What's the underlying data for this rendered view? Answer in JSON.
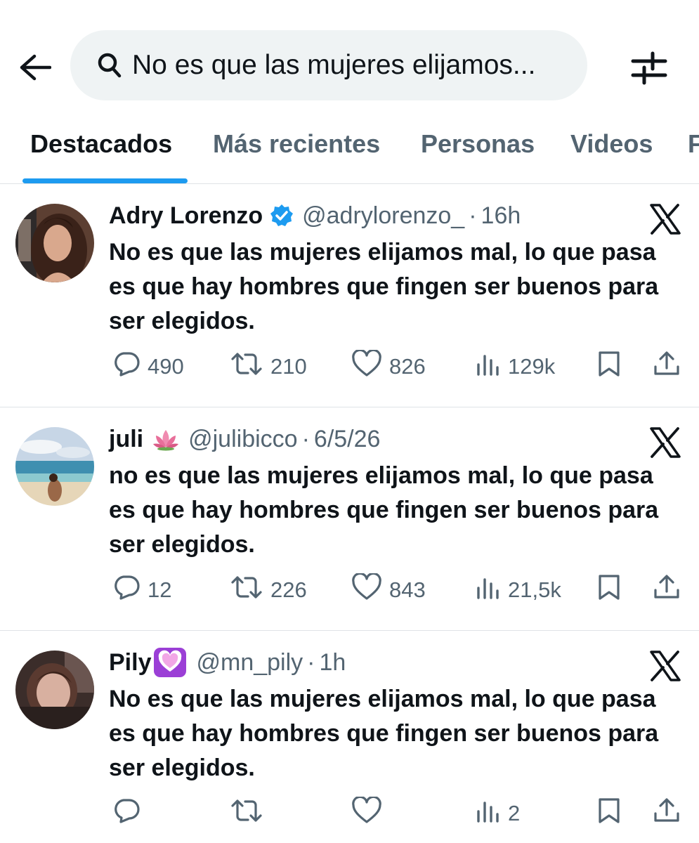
{
  "search": {
    "query": "No es que las mujeres elijamos..."
  },
  "tabs": [
    {
      "label": "Destacados",
      "active": true
    },
    {
      "label": "Más recientes",
      "active": false
    },
    {
      "label": "Personas",
      "active": false
    },
    {
      "label": "Videos",
      "active": false
    },
    {
      "label": "F",
      "active": false
    }
  ],
  "tweets": [
    {
      "name": "Adry Lorenzo",
      "verified": true,
      "handle": "@adrylorenzo_",
      "time": "16h",
      "text": "No es que las mujeres elijamos mal, lo que pasa es que hay hombres que fingen ser buenos para ser elegidos.",
      "replies": "490",
      "retweets": "210",
      "likes": "826",
      "views": "129k"
    },
    {
      "name": "juli",
      "emoji": "lotus-emoji",
      "handle": "@julibicco",
      "time": "6/5/26",
      "text": "no es que las mujeres elijamos mal, lo que pasa es que hay hombres que fingen ser buenos para ser elegidos.",
      "replies": "12",
      "retweets": "226",
      "likes": "843",
      "views": "21,5k"
    },
    {
      "name": "Pily",
      "emoji": "purple-heart-emoji",
      "handle": "@mn_pily",
      "time": "1h",
      "text": "No es que las mujeres elijamos mal, lo que pasa es que hay hombres que fingen ser buenos para ser elegidos.",
      "replies": "",
      "retweets": "",
      "likes": "",
      "views": "2"
    }
  ],
  "colors": {
    "accent": "#1d9bf0",
    "text": "#0f1419",
    "secondary": "#536471",
    "search_bg": "#eff3f4",
    "divider": "#dfe3e6"
  },
  "separator": "·"
}
